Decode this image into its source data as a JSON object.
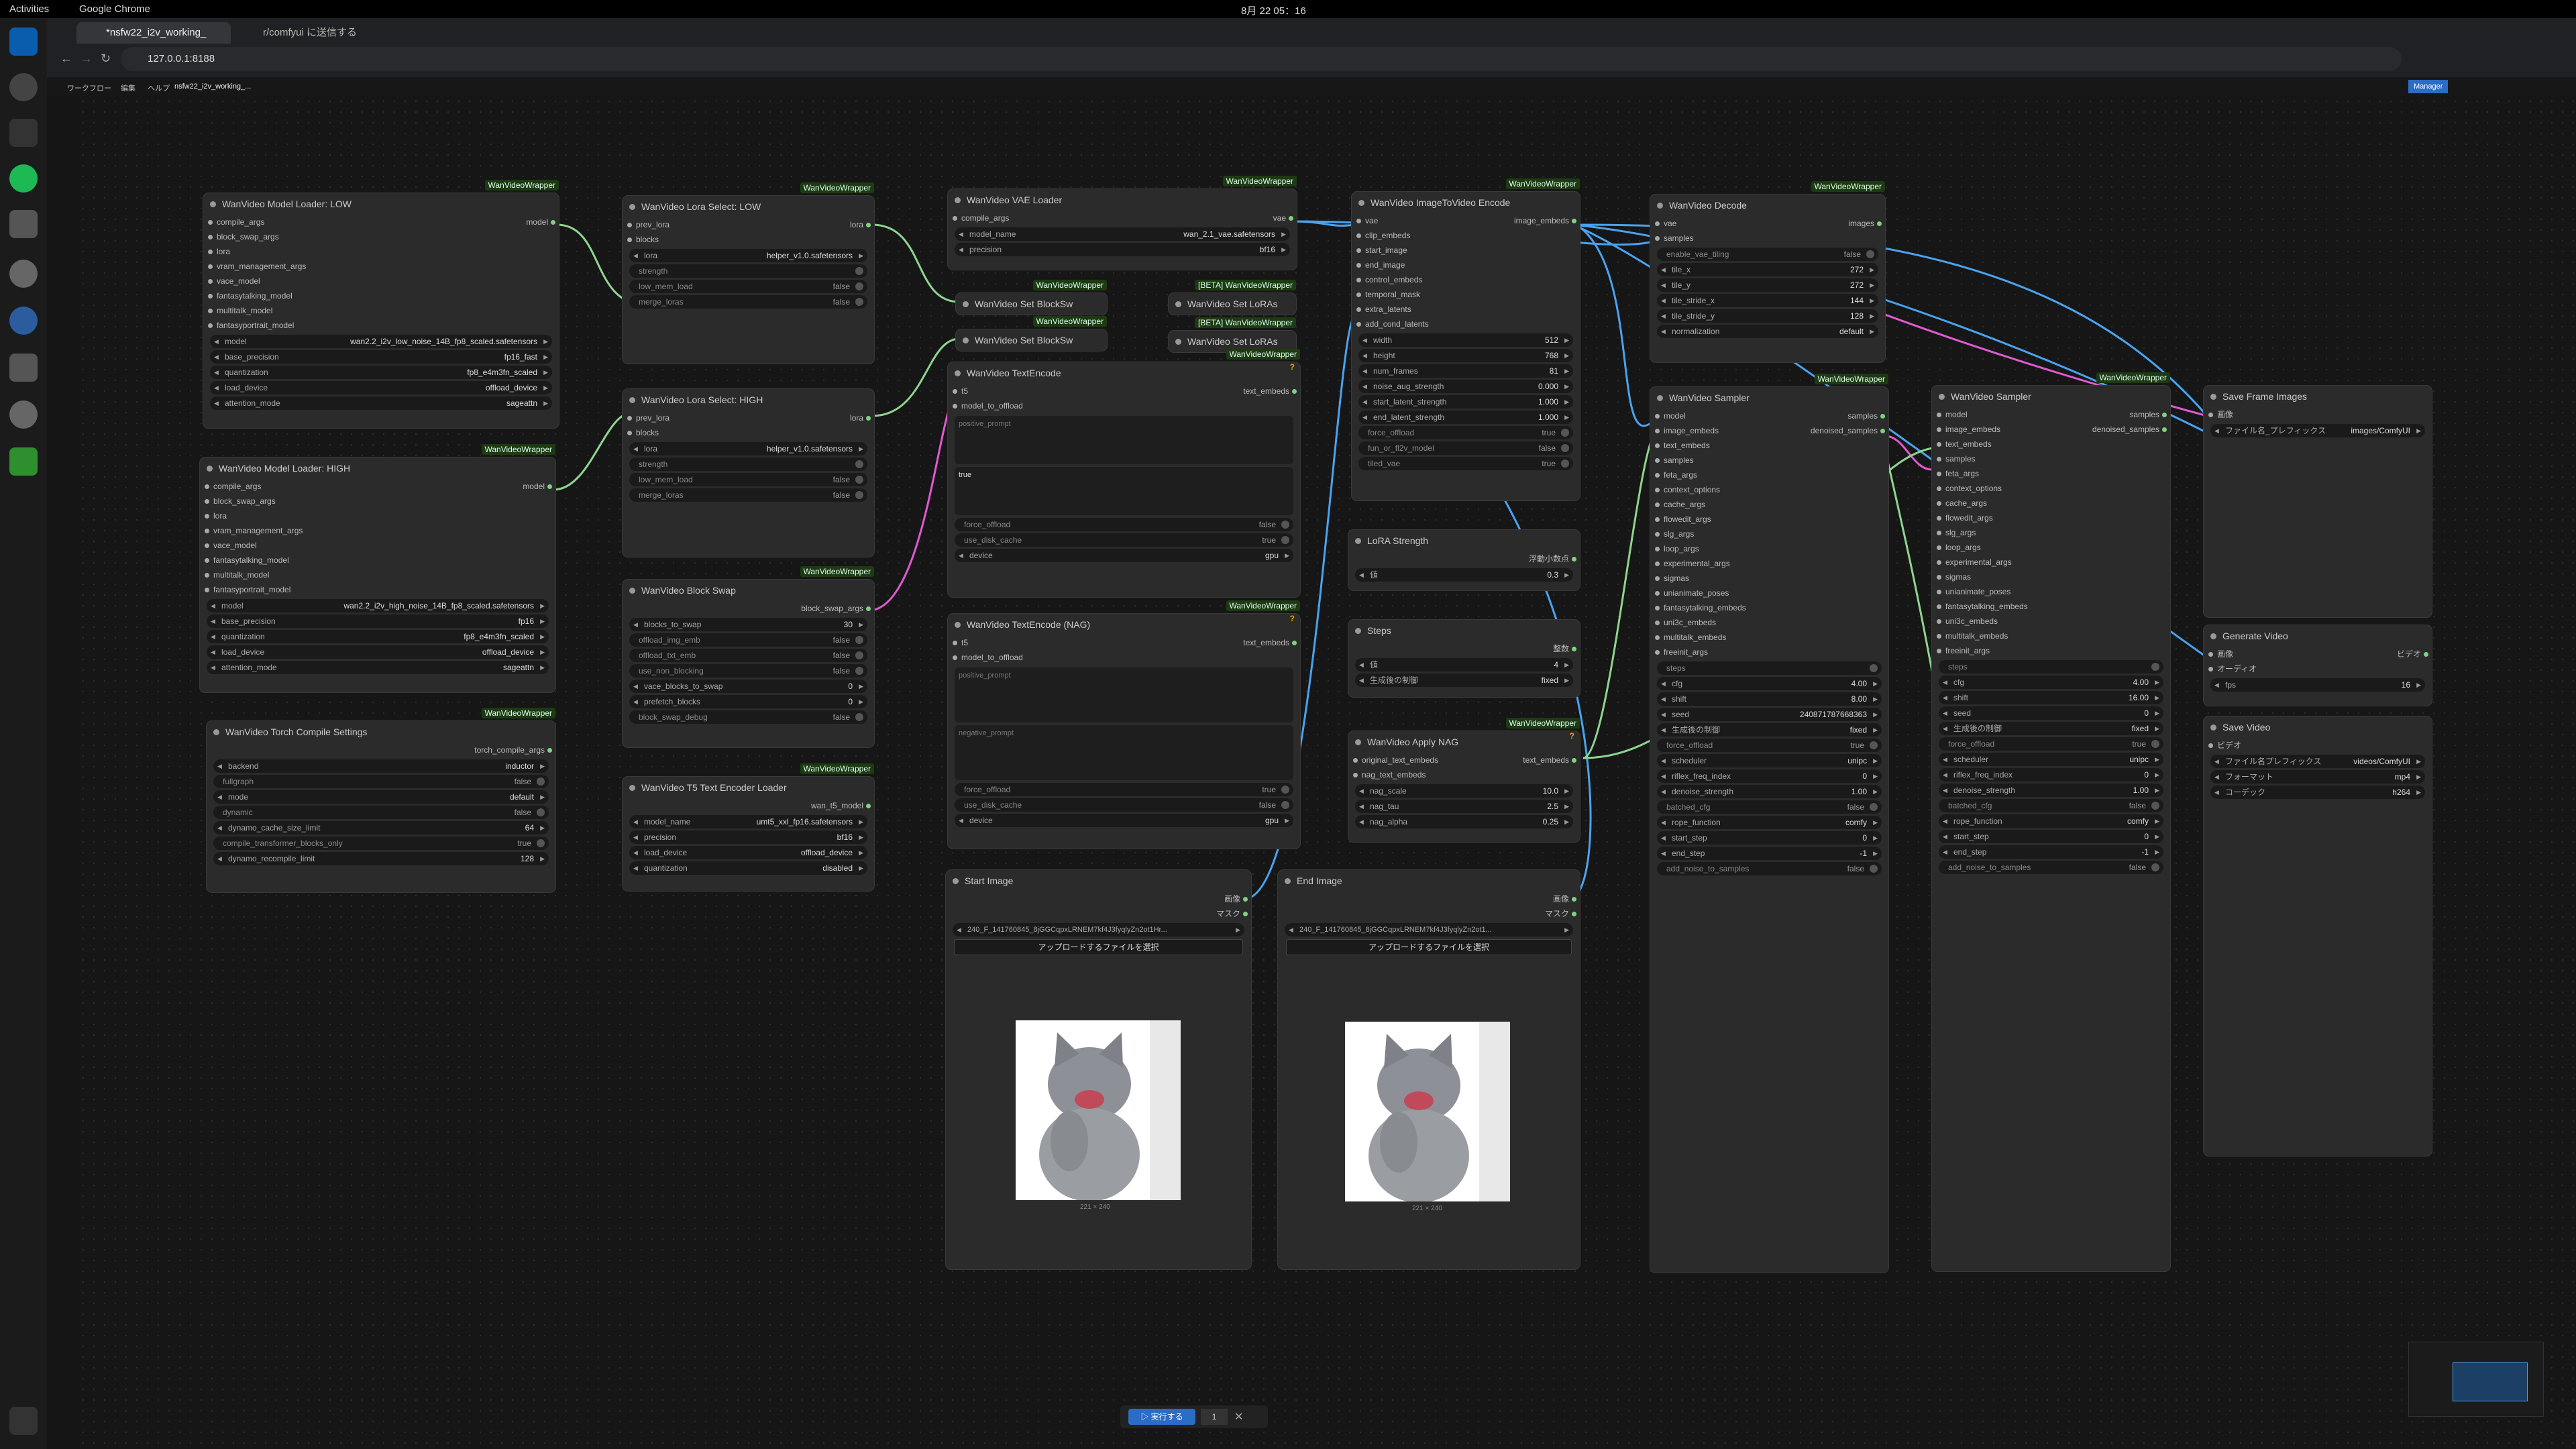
{
  "system": {
    "activities": "Activities",
    "app": "Google Chrome",
    "clock": "8月 22  05：16"
  },
  "browser": {
    "tabs": [
      {
        "label": "*nsfw22_i2v_working_"
      },
      {
        "label": "r/comfyui に送信する"
      }
    ],
    "url": "127.0.0.1:8188"
  },
  "comfy_menu": {
    "items": [
      "ワークフロー",
      "編集",
      "ヘルプ"
    ],
    "workflow_tab": "nsfw22_i2v_working_...",
    "manager": "Manager"
  },
  "nodes": {
    "loader_low": {
      "badge": "WanVideoWrapper",
      "title": "WanVideo Model Loader: LOW",
      "inputs": [
        "compile_args",
        "block_swap_args",
        "lora",
        "vram_management_args",
        "vace_model",
        "fantasytalking_model",
        "multitalk_model",
        "fantasyportrait_model"
      ],
      "output": "model",
      "widgets": [
        {
          "k": "model",
          "v": "wan2.2_i2v_low_noise_14B_fp8_scaled.safetensors"
        },
        {
          "k": "base_precision",
          "v": "fp16_fast"
        },
        {
          "k": "quantization",
          "v": "fp8_e4m3fn_scaled"
        },
        {
          "k": "load_device",
          "v": "offload_device"
        },
        {
          "k": "attention_mode",
          "v": "sageattn"
        }
      ]
    },
    "loader_high": {
      "badge": "WanVideoWrapper",
      "title": "WanVideo Model Loader: HIGH",
      "inputs": [
        "compile_args",
        "block_swap_args",
        "lora",
        "vram_management_args",
        "vace_model",
        "fantasytalking_model",
        "multitalk_model",
        "fantasyportrait_model"
      ],
      "output": "model",
      "widgets": [
        {
          "k": "model",
          "v": "wan2.2_i2v_high_noise_14B_fp8_scaled.safetensors"
        },
        {
          "k": "base_precision",
          "v": "fp16"
        },
        {
          "k": "quantization",
          "v": "fp8_e4m3fn_scaled"
        },
        {
          "k": "load_device",
          "v": "offload_device"
        },
        {
          "k": "attention_mode",
          "v": "sageattn"
        }
      ]
    },
    "torch_compile": {
      "badge": "WanVideoWrapper",
      "title": "WanVideo Torch Compile Settings",
      "output": "torch_compile_args",
      "widgets": [
        {
          "k": "backend",
          "v": "inductor"
        },
        {
          "k": "fullgraph",
          "v": "false"
        },
        {
          "k": "mode",
          "v": "default"
        },
        {
          "k": "dynamic",
          "v": "false"
        },
        {
          "k": "dynamo_cache_size_limit",
          "v": "64"
        },
        {
          "k": "compile_transformer_blocks_only",
          "v": "true"
        },
        {
          "k": "dynamo_recompile_limit",
          "v": "128"
        }
      ]
    },
    "lora_low": {
      "badge": "WanVideoWrapper",
      "title": "WanVideo Lora Select: LOW",
      "inputs": [
        "prev_lora",
        "blocks"
      ],
      "output": "lora",
      "lora": "helper_v1.0.safetensors",
      "strength": "strength",
      "toggles": [
        {
          "k": "low_mem_load",
          "v": "false"
        },
        {
          "k": "merge_loras",
          "v": "false"
        }
      ]
    },
    "lora_high": {
      "title": "WanVideo Lora Select: HIGH",
      "inputs": [
        "prev_lora",
        "blocks"
      ],
      "output": "lora",
      "lora": "helper_v1.0.safetensors",
      "strength": "strength",
      "toggles": [
        {
          "k": "low_mem_load",
          "v": "false"
        },
        {
          "k": "merge_loras",
          "v": "false"
        }
      ]
    },
    "block_swap": {
      "badge": "WanVideoWrapper",
      "title": "WanVideo Block Swap",
      "output": "block_swap_args",
      "widgets": [
        {
          "k": "blocks_to_swap",
          "v": "30"
        },
        {
          "k": "offload_img_emb",
          "v": "false"
        },
        {
          "k": "offload_txt_emb",
          "v": "false"
        },
        {
          "k": "use_non_blocking",
          "v": "false"
        },
        {
          "k": "vace_blocks_to_swap",
          "v": "0"
        },
        {
          "k": "prefetch_blocks",
          "v": "0"
        },
        {
          "k": "block_swap_debug",
          "v": "false"
        }
      ]
    },
    "t5": {
      "badge": "WanVideoWrapper",
      "title": "WanVideo T5 Text Encoder Loader",
      "output": "wan_t5_model",
      "widgets": [
        {
          "k": "model_name",
          "v": "umt5_xxl_fp16.safetensors"
        },
        {
          "k": "precision",
          "v": "bf16"
        },
        {
          "k": "load_device",
          "v": "offload_device"
        },
        {
          "k": "quantization",
          "v": "disabled"
        }
      ]
    },
    "vae": {
      "badge": "WanVideoWrapper",
      "title": "WanVideo VAE Loader",
      "inputs": [
        "compile_args"
      ],
      "output": "vae",
      "widgets": [
        {
          "k": "model_name",
          "v": "wan_2.1_vae.safetensors"
        },
        {
          "k": "precision",
          "v": "bf16"
        }
      ]
    },
    "bs1": {
      "badge": "WanVideoWrapper",
      "title": "WanVideo Set BlockSw"
    },
    "bs2": {
      "badge": "WanVideoWrapper",
      "title": "WanVideo Set BlockSw"
    },
    "sl1": {
      "badge": "[BETA] WanVideoWrapper",
      "title": "WanVideo Set LoRAs"
    },
    "sl2": {
      "badge": "[BETA] WanVideoWrapper",
      "title": "WanVideo Set LoRAs"
    },
    "textenc": {
      "badge": "WanVideoWrapper",
      "title": "WanVideo TextEncode",
      "inputs": [
        "t5",
        "model_to_offload"
      ],
      "output": "text_embeds",
      "pos_placeholder": "positive_prompt",
      "neg_value": "true",
      "widgets": [
        {
          "k": "force_offload",
          "v": "false"
        },
        {
          "k": "use_disk_cache",
          "v": "true"
        },
        {
          "k": "device",
          "v": "gpu"
        }
      ]
    },
    "textenc_nag": {
      "badge": "WanVideoWrapper",
      "title": "WanVideo TextEncode (NAG)",
      "inputs": [
        "t5",
        "model_to_offload"
      ],
      "output": "text_embeds",
      "pos_placeholder": "positive_prompt",
      "neg_placeholder": "negative_prompt",
      "widgets": [
        {
          "k": "force_offload",
          "v": "true"
        },
        {
          "k": "use_disk_cache",
          "v": "false"
        },
        {
          "k": "device",
          "v": "gpu"
        }
      ]
    },
    "start_image": {
      "title": "Start Image",
      "outputs": [
        "画像",
        "マスク"
      ],
      "file": "240_F_141760845_8jGGCqpxLRNEM7kf4J3fyqlyZn2ot1Hr...",
      "upload": "アップロードするファイルを選択",
      "dims": "221 × 240"
    },
    "end_image": {
      "title": "End Image",
      "outputs": [
        "画像",
        "マスク"
      ],
      "file": "240_F_141760845_8jGGCqpxLRNEM7kf4J3fyqlyZn2ot1...",
      "upload": "アップロードするファイルを選択",
      "dims": "221 × 240"
    },
    "img2vid": {
      "badge": "WanVideoWrapper",
      "title": "WanVideo ImageToVideo Encode",
      "inputs": [
        "vae",
        "clip_embeds",
        "start_image",
        "end_image",
        "control_embeds",
        "temporal_mask",
        "extra_latents",
        "add_cond_latents"
      ],
      "output": "image_embeds",
      "widgets": [
        {
          "k": "width",
          "v": "512"
        },
        {
          "k": "height",
          "v": "768"
        },
        {
          "k": "num_frames",
          "v": "81"
        },
        {
          "k": "noise_aug_strength",
          "v": "0.000"
        },
        {
          "k": "start_latent_strength",
          "v": "1.000"
        },
        {
          "k": "end_latent_strength",
          "v": "1.000"
        },
        {
          "k": "force_offload",
          "v": "true"
        },
        {
          "k": "fun_or_fl2v_model",
          "v": "false"
        },
        {
          "k": "tiled_vae",
          "v": "true"
        }
      ]
    },
    "lora_strength": {
      "title": "LoRA Strength",
      "output": "浮動小数点",
      "widget": {
        "k": "値",
        "v": "0.3"
      }
    },
    "steps": {
      "title": "Steps",
      "output": "整数",
      "widgets": [
        {
          "k": "値",
          "v": "4"
        },
        {
          "k": "生成後の制御",
          "v": "fixed"
        }
      ]
    },
    "apply_nag": {
      "badge": "WanVideoWrapper",
      "title": "WanVideo Apply NAG",
      "inputs": [
        "original_text_embeds",
        "nag_text_embeds"
      ],
      "output": "text_embeds",
      "widgets": [
        {
          "k": "nag_scale",
          "v": "10.0"
        },
        {
          "k": "nag_tau",
          "v": "2.5"
        },
        {
          "k": "nag_alpha",
          "v": "0.25"
        }
      ]
    },
    "decode": {
      "badge": "WanVideoWrapper",
      "title": "WanVideo Decode",
      "inputs": [
        "vae",
        "samples"
      ],
      "output": "images",
      "widgets": [
        {
          "k": "enable_vae_tiling",
          "v": "false"
        },
        {
          "k": "tile_x",
          "v": "272"
        },
        {
          "k": "tile_y",
          "v": "272"
        },
        {
          "k": "tile_stride_x",
          "v": "144"
        },
        {
          "k": "tile_stride_y",
          "v": "128"
        },
        {
          "k": "normalization",
          "v": "default"
        }
      ]
    },
    "sampler1": {
      "badge": "WanVideoWrapper",
      "title": "WanVideo Sampler",
      "inputs": [
        "model",
        "image_embeds",
        "text_embeds",
        "samples",
        "feta_args",
        "context_options",
        "cache_args",
        "flowedit_args",
        "slg_args",
        "loop_args",
        "experimental_args",
        "sigmas",
        "unianimate_poses",
        "fantasytalking_embeds",
        "uni3c_embeds",
        "multitalk_embeds",
        "freeinit_args",
        "steps"
      ],
      "outputs": [
        "samples",
        "denoised_samples"
      ],
      "widgets": [
        {
          "k": "cfg",
          "v": "4.00"
        },
        {
          "k": "shift",
          "v": "8.00"
        },
        {
          "k": "seed",
          "v": "240871787668363"
        },
        {
          "k": "生成後の制御",
          "v": "fixed"
        },
        {
          "k": "force_offload",
          "v": "true"
        },
        {
          "k": "scheduler",
          "v": "unipc"
        },
        {
          "k": "riflex_freq_index",
          "v": "0"
        },
        {
          "k": "denoise_strength",
          "v": "1.00"
        },
        {
          "k": "batched_cfg",
          "v": "false"
        },
        {
          "k": "rope_function",
          "v": "comfy"
        },
        {
          "k": "start_step",
          "v": "0"
        },
        {
          "k": "end_step",
          "v": "-1"
        },
        {
          "k": "add_noise_to_samples",
          "v": "false"
        }
      ]
    },
    "sampler2": {
      "badge": "WanVideoWrapper",
      "title": "WanVideo Sampler",
      "inputs": [
        "model",
        "image_embeds",
        "text_embeds",
        "samples",
        "feta_args",
        "context_options",
        "cache_args",
        "flowedit_args",
        "slg_args",
        "loop_args",
        "experimental_args",
        "sigmas",
        "unianimate_poses",
        "fantasytalking_embeds",
        "uni3c_embeds",
        "multitalk_embeds",
        "freeinit_args",
        "steps"
      ],
      "outputs": [
        "samples",
        "denoised_samples"
      ],
      "widgets": [
        {
          "k": "cfg",
          "v": "4.00"
        },
        {
          "k": "shift",
          "v": "16.00"
        },
        {
          "k": "seed",
          "v": "0"
        },
        {
          "k": "生成後の制御",
          "v": "fixed"
        },
        {
          "k": "force_offload",
          "v": "true"
        },
        {
          "k": "scheduler",
          "v": "unipc"
        },
        {
          "k": "riflex_freq_index",
          "v": "0"
        },
        {
          "k": "denoise_strength",
          "v": "1.00"
        },
        {
          "k": "batched_cfg",
          "v": "false"
        },
        {
          "k": "rope_function",
          "v": "comfy"
        },
        {
          "k": "start_step",
          "v": "0"
        },
        {
          "k": "end_step",
          "v": "-1"
        },
        {
          "k": "add_noise_to_samples",
          "v": "false"
        }
      ]
    },
    "save_frame": {
      "title": "Save Frame Images",
      "input": "画像",
      "widget": {
        "k": "ファイル名_プレフィックス",
        "v": "images/ComfyUI"
      }
    },
    "gen_video": {
      "title": "Generate Video",
      "inputs": [
        "画像",
        "オーディオ"
      ],
      "output": "ビデオ",
      "widget": {
        "k": "fps",
        "v": "16"
      }
    },
    "save_video": {
      "title": "Save Video",
      "input": "ビデオ",
      "widgets": [
        {
          "k": "ファイル名プレフィックス",
          "v": "videos/ComfyUI"
        },
        {
          "k": "フォーマット",
          "v": "mp4"
        },
        {
          "k": "コーデック",
          "v": "h264"
        }
      ]
    }
  },
  "run_bar": {
    "label": "実行する",
    "count": "1"
  },
  "colors": {
    "link_blue": "#4aa3f0",
    "link_pink": "#e05ad0",
    "link_green": "#8fd48f",
    "badge": "#1d3a12"
  }
}
